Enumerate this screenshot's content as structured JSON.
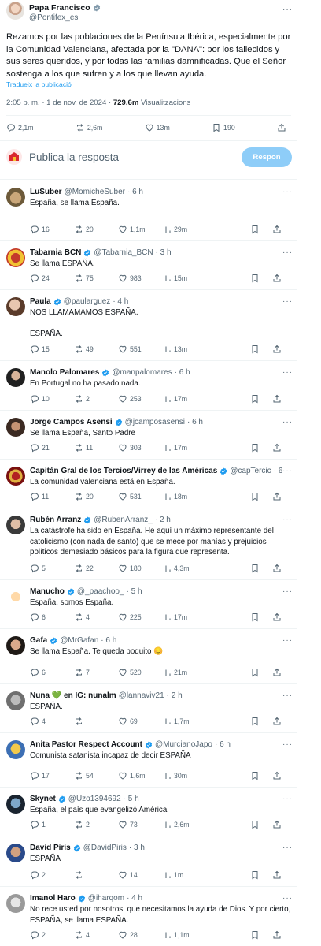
{
  "main_post": {
    "author": "Papa Francisco",
    "handle": "@Pontifex_es",
    "text": "Rezamos por las poblaciones de la Península Ibérica, especialmente por la Comunidad Valenciana, afectada por la \"DANA\": por los fallecidos y sus seres queridos, y por todas las familias damnificadas. Que el Señor sostenga a los que sufren y a los que llevan ayuda.",
    "translate_link": "Tradueix la publicació",
    "time": "2:05 p. m. · 1 de nov. de 2024 · ",
    "views": "729,6m",
    "views_label": " Visualitzacions",
    "stats": {
      "replies": "2,1m",
      "reposts": "2,6m",
      "likes": "13m",
      "bookmarks": "190"
    }
  },
  "composer": {
    "placeholder": "Publica la resposta",
    "button": "Respon"
  },
  "colors": {
    "accent": "#1d9bf0",
    "verified": "#1d9bf0",
    "text": "#0f1419",
    "muted": "#536471"
  },
  "replies": [
    {
      "name": "LuSuber",
      "handle": "@MomicheSuber",
      "time": "· 6 h",
      "text": "España, se llama España.",
      "replies": "16",
      "reposts": "20",
      "likes": "1,1m",
      "views": "29m",
      "verified": false
    },
    {
      "name": "Tabarnia BCN",
      "handle": "@Tabarnia_BCN",
      "time": "· 3 h",
      "text": "Se llama ESPAÑA.",
      "replies": "24",
      "reposts": "75",
      "likes": "983",
      "views": "15m",
      "verified": true
    },
    {
      "name": "Paula",
      "handle": "@paularguez",
      "time": "· 4 h",
      "text": "NOS LLAMAMAMOS ESPAÑA.\n\nESPAÑA.",
      "replies": "15",
      "reposts": "49",
      "likes": "551",
      "views": "13m",
      "verified": true
    },
    {
      "name": "Manolo Palomares",
      "handle": "@manpalomares",
      "time": "· 6 h",
      "text": "En Portugal no ha pasado nada.",
      "replies": "10",
      "reposts": "2",
      "likes": "253",
      "views": "17m",
      "verified": true
    },
    {
      "name": "Jorge Campos Asensi",
      "handle": "@jcamposasensi",
      "time": "· 6 h",
      "text": "Se llama España, Santo Padre",
      "replies": "21",
      "reposts": "11",
      "likes": "303",
      "views": "17m",
      "verified": true
    },
    {
      "name": "Capitán Gral de los Tercios/Virrey de las Américas",
      "handle": "@capTercic",
      "time": "· 6 h",
      "text": "La comunidad valenciana está en España.",
      "replies": "11",
      "reposts": "20",
      "likes": "531",
      "views": "18m",
      "verified": true
    },
    {
      "name": "Rubén Arranz",
      "handle": "@RubenArranz_",
      "time": "· 2 h",
      "text": "La catástrofe ha sido en España. He aquí un máximo representante del catolicismo (con nada de santo) que se mece por manías y prejuicios políticos demasiado básicos para la figura que representa.",
      "replies": "5",
      "reposts": "22",
      "likes": "180",
      "views": "4,3m",
      "verified": true
    },
    {
      "name": "Manucho",
      "handle": "@_paachoo_",
      "time": "· 5 h",
      "text": "España, somos España.",
      "replies": "6",
      "reposts": "4",
      "likes": "225",
      "views": "17m",
      "verified": true
    },
    {
      "name": "Gafa",
      "handle": "@MrGafan",
      "time": "· 6 h",
      "text": "Se llama España. Te queda poquito 😊",
      "replies": "6",
      "reposts": "7",
      "likes": "520",
      "views": "21m",
      "verified": true
    },
    {
      "name": "Nuna 💚 en IG: nunalm",
      "handle": "@lannaviv21",
      "time": "· 2 h",
      "text": "ESPAÑA.",
      "replies": "4",
      "reposts": "",
      "likes": "69",
      "views": "1,7m",
      "verified": false
    },
    {
      "name": "Anita Pastor Respect Account",
      "handle": "@MurcianoJapo",
      "time": "· 6 h",
      "text": "Comunista satanista incapaz de decir ESPAÑA",
      "replies": "17",
      "reposts": "54",
      "likes": "1,6m",
      "views": "30m",
      "verified": true
    },
    {
      "name": "Skynet",
      "handle": "@Uzo1394692",
      "time": "· 5 h",
      "text": "España, el país que evangelizó América",
      "replies": "1",
      "reposts": "2",
      "likes": "73",
      "views": "2,6m",
      "verified": true
    },
    {
      "name": "David Piris",
      "handle": "@DavidPiris",
      "time": "· 3 h",
      "text": "ESPAÑA",
      "replies": "2",
      "reposts": "",
      "likes": "14",
      "views": "1m",
      "verified": true
    },
    {
      "name": "Imanol Haro",
      "handle": "@iharqom",
      "time": "· 4 h",
      "text": "No rece usted por nosotros, que necesitamos la ayuda de Dios. Y por cierto, ESPAÑA, se llama ESPAÑA.",
      "replies": "2",
      "reposts": "4",
      "likes": "28",
      "views": "1,1m",
      "verified": true
    }
  ]
}
